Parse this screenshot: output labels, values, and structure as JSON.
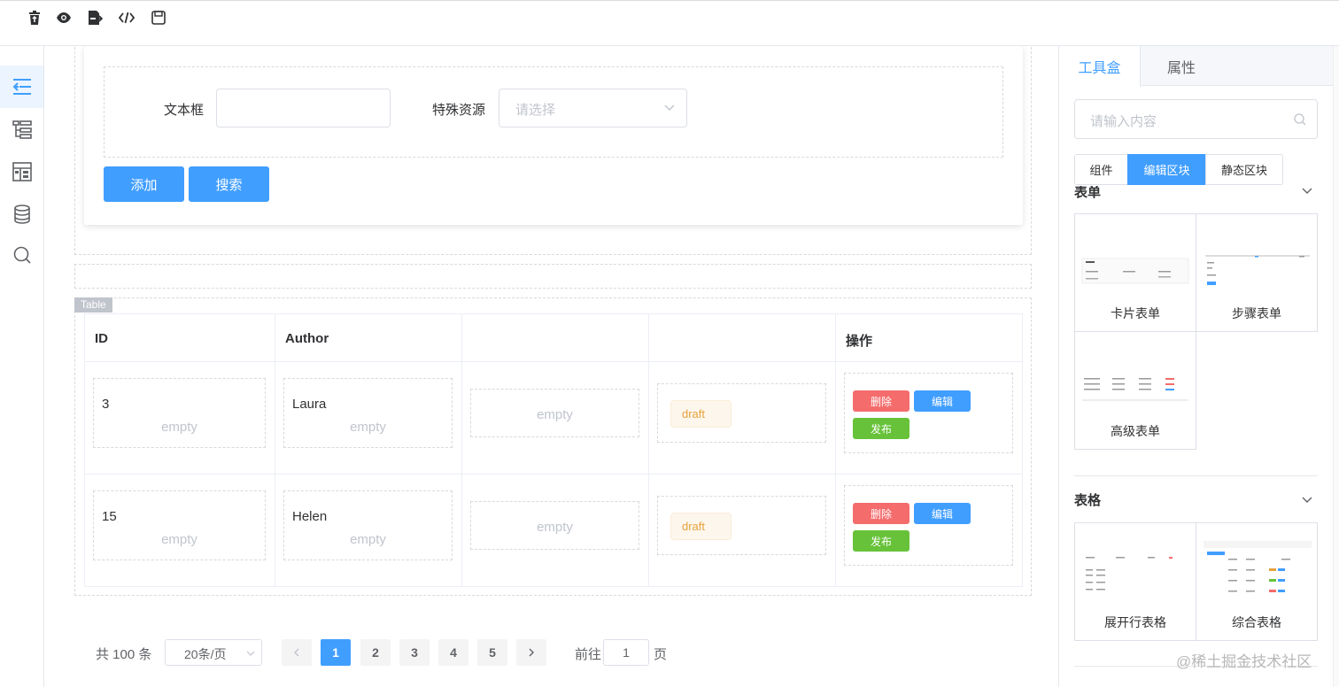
{
  "toolbar": {
    "icons": [
      "trash-icon",
      "eye-icon",
      "export-icon",
      "code-icon",
      "save-icon"
    ]
  },
  "rail": {
    "items": [
      "collapse-icon",
      "tree-icon",
      "layout-icon",
      "database-icon",
      "search-icon"
    ],
    "active_index": 0
  },
  "form": {
    "text_label": "文本框",
    "select_label": "特殊资源",
    "select_placeholder": "请选择",
    "add_button": "添加",
    "search_button": "搜索"
  },
  "table": {
    "tag": "Table",
    "headers": [
      "ID",
      "Author",
      "",
      "",
      "操作"
    ],
    "empty_text": "empty",
    "rows": [
      {
        "id": "3",
        "author": "Laura",
        "status": "draft",
        "actions": {
          "delete": "删除",
          "edit": "编辑",
          "publish": "发布"
        }
      },
      {
        "id": "15",
        "author": "Helen",
        "status": "draft",
        "actions": {
          "delete": "删除",
          "edit": "编辑",
          "publish": "发布"
        }
      }
    ]
  },
  "pagination": {
    "total": "共 100 条",
    "page_size": "20条/页",
    "pages": [
      "1",
      "2",
      "3",
      "4",
      "5"
    ],
    "current_page": "1",
    "goto_label": "前往",
    "goto_value": "1",
    "goto_suffix": "页"
  },
  "panel": {
    "tabs": [
      "工具盒",
      "属性"
    ],
    "active_tab": "工具盒",
    "search_placeholder": "请输入内容",
    "segments": [
      "组件",
      "编辑区块",
      "静态区块"
    ],
    "active_segment": "编辑区块",
    "sections": [
      {
        "title": "表单",
        "items": [
          "卡片表单",
          "步骤表单",
          "高级表单"
        ]
      },
      {
        "title": "表格",
        "items": [
          "展开行表格",
          "综合表格"
        ]
      }
    ]
  },
  "watermark": "@稀土掘金技术社区",
  "colors": {
    "primary": "#409eff",
    "danger": "#f56c6c",
    "success": "#67c23a",
    "warning": "#e6a23c"
  }
}
